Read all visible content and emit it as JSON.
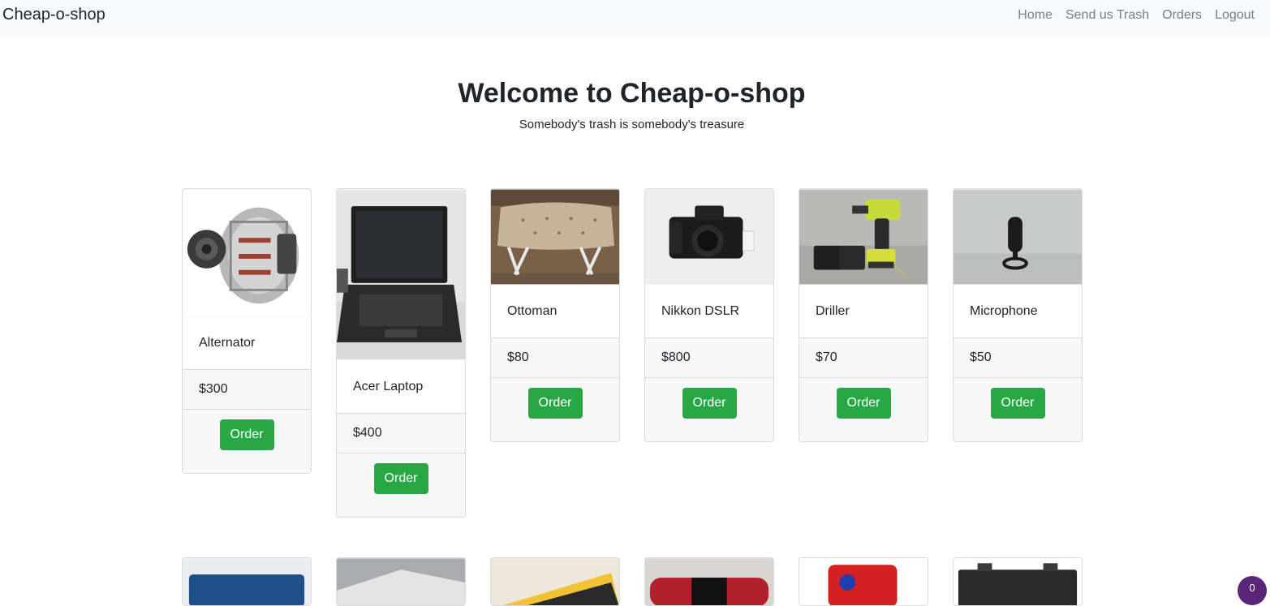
{
  "nav": {
    "brand": "Cheap-o-shop",
    "links": [
      "Home",
      "Send us Trash",
      "Orders",
      "Logout"
    ]
  },
  "hero": {
    "title": "Welcome to Cheap-o-shop",
    "subtitle": "Somebody's trash is somebody's treasure"
  },
  "products": [
    {
      "name": "Alternator",
      "price": "$300",
      "button": "Order"
    },
    {
      "name": "Acer Laptop",
      "price": "$400",
      "button": "Order"
    },
    {
      "name": "Ottoman",
      "price": "$80",
      "button": "Order"
    },
    {
      "name": "Nikkon DSLR",
      "price": "$800",
      "button": "Order"
    },
    {
      "name": "Driller",
      "price": "$70",
      "button": "Order"
    },
    {
      "name": "Microphone",
      "price": "$50",
      "button": "Order"
    }
  ],
  "corner_badge": "0"
}
